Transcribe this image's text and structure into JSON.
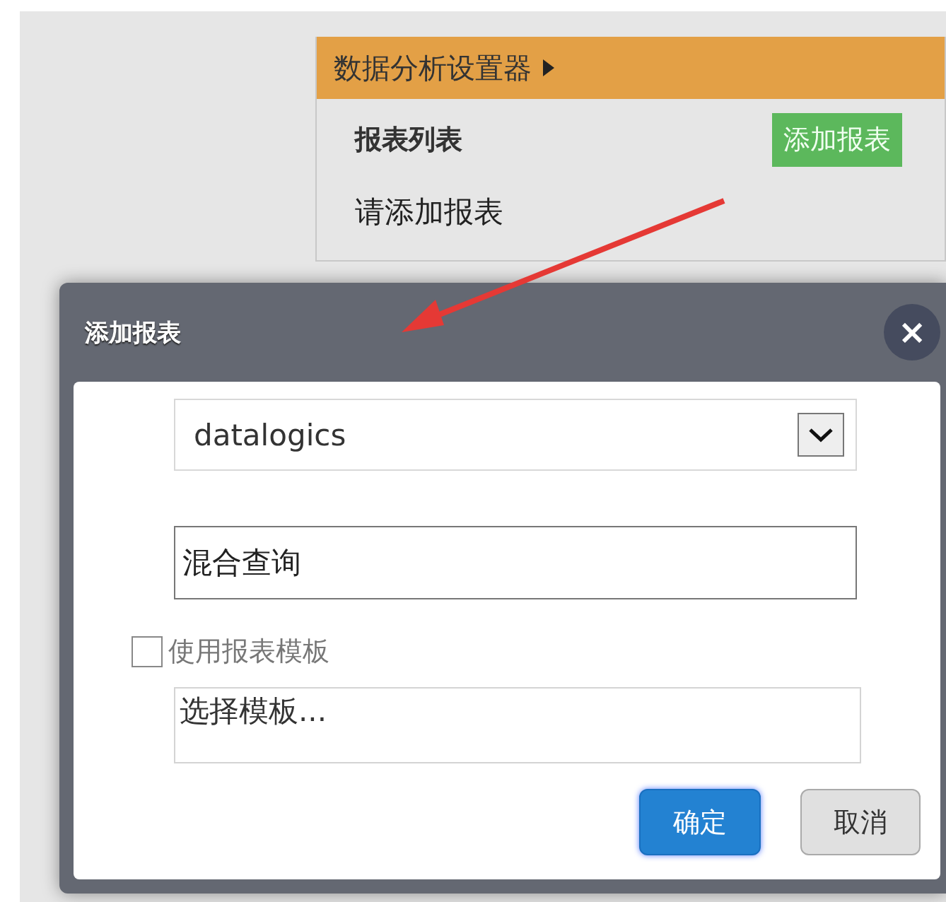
{
  "panel": {
    "title": "数据分析设置器",
    "list_heading": "报表列表",
    "add_button": "添加报表",
    "empty_text": "请添加报表"
  },
  "dialog": {
    "title": "添加报表",
    "close": "×",
    "source_select": {
      "value": "datalogics"
    },
    "name_field": {
      "value": "混合查询"
    },
    "template_checkbox": {
      "label": "使用报表模板",
      "checked": false
    },
    "template_field": {
      "value": "选择模板..."
    },
    "buttons": [
      {
        "label": "确定",
        "kind": "primary"
      },
      {
        "label": "取消",
        "kind": "secondary"
      }
    ]
  }
}
